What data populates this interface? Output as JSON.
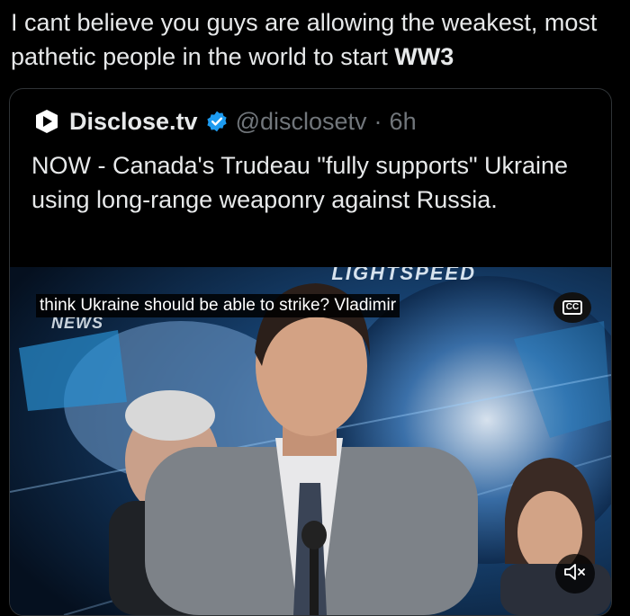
{
  "post": {
    "text_main": "I cant believe you guys are allowing the weakest, most pathetic people in the world to start",
    "text_bold": "WW3"
  },
  "quote": {
    "name": "Disclose.tv",
    "handle": "@disclosetv",
    "separator": "·",
    "time": "6h",
    "text": "NOW - Canada's Trudeau \"fully supports\" Ukraine using long-range weaponry against Russia.",
    "verified_color": "#1d9bf0"
  },
  "video": {
    "caption": "think Ukraine should be able to strike? Vladimir",
    "cc_label": "CC",
    "logo_text": "NEWS",
    "backdrop_text": "LIGHTSPEED",
    "mute_icon": "muted-speaker-icon"
  }
}
